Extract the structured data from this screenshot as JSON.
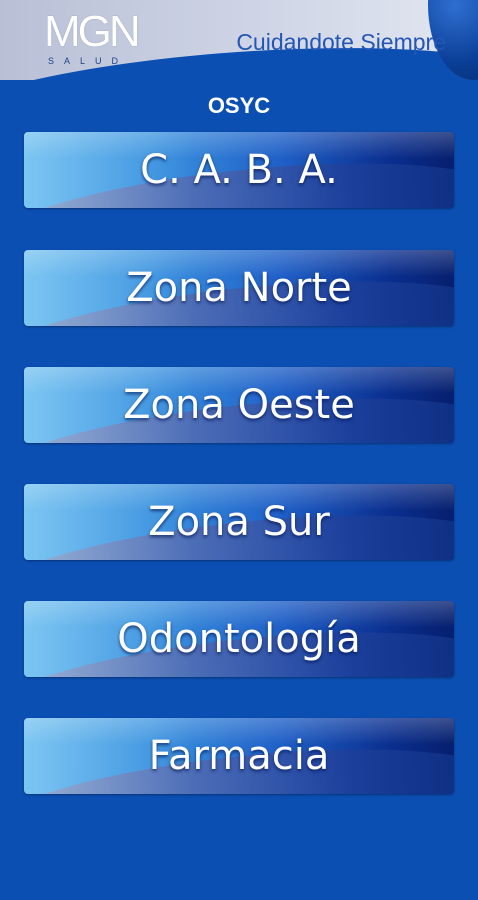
{
  "header": {
    "logo_text": "MGN",
    "logo_subtext": "SALUD",
    "tagline": "Cuidandote Siempre"
  },
  "section": {
    "title": "OSYC"
  },
  "menu": {
    "items": [
      {
        "label": "C. A. B. A."
      },
      {
        "label": "Zona Norte"
      },
      {
        "label": "Zona Oeste"
      },
      {
        "label": "Zona Sur"
      },
      {
        "label": "Odontología"
      },
      {
        "label": "Farmacia"
      }
    ]
  },
  "colors": {
    "background": "#0b4fb3",
    "header_light": "#cfd5e6",
    "button_light": "#5fb9ef",
    "button_dark": "#061f6e",
    "text": "#ffffff"
  }
}
